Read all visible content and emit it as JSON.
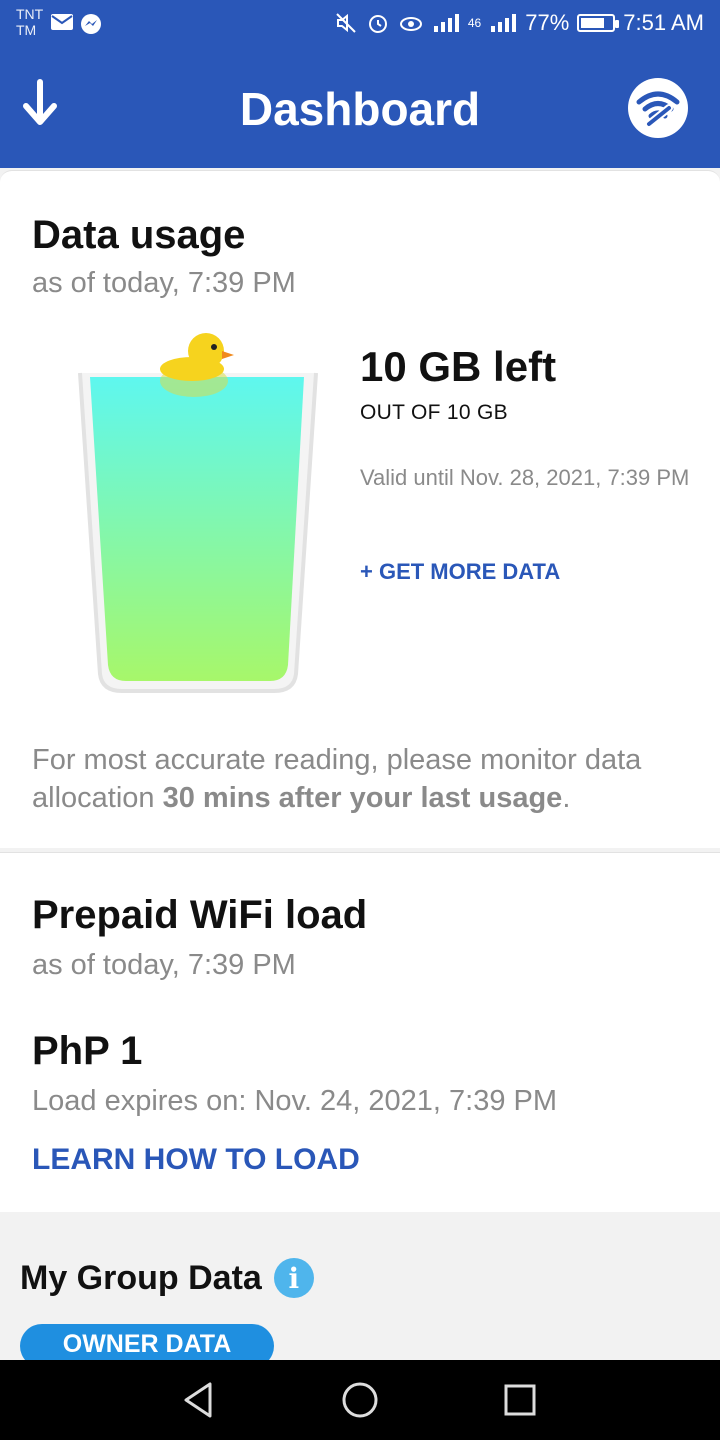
{
  "status": {
    "carrier_line1": "TNT",
    "carrier_line2": "TM",
    "signal": "46",
    "battery": "77%",
    "battery_level": 0.77,
    "time": "7:51 AM"
  },
  "appbar": {
    "title": "Dashboard",
    "left_icon": "download-arrow-icon",
    "right_icon": "wifi-wrench-icon"
  },
  "data_usage": {
    "title": "Data usage",
    "as_of": "as of today, 7:39 PM",
    "left_amount": "10 GB left",
    "out_of": "OUT OF 10 GB",
    "valid_until": "Valid until Nov. 28, 2021, 7:39 PM",
    "get_more": "+ GET MORE DATA",
    "note_prefix": "For most accurate reading, please monitor data allocation ",
    "note_bold": "30 mins after your last usage",
    "note_suffix": ".",
    "fill_level": 1.0
  },
  "prepaid": {
    "title": "Prepaid WiFi load",
    "as_of": "as of today, 7:39 PM",
    "amount": "PhP 1",
    "expires": "Load expires on: Nov. 24, 2021, 7:39 PM",
    "learn": "LEARN HOW TO LOAD"
  },
  "group": {
    "title": "My Group Data",
    "info": "i",
    "owner_button": "OWNER DATA"
  },
  "colors": {
    "brand": "#2a57b8",
    "accent": "#1f8fe0",
    "info": "#4fb5ec"
  }
}
